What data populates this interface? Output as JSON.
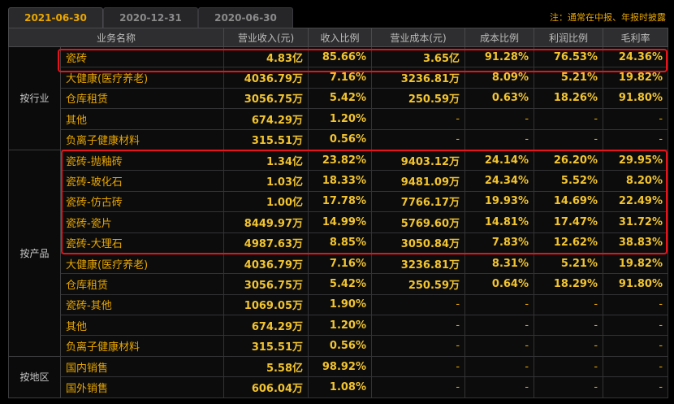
{
  "tabs": [
    "2021-06-30",
    "2020-12-31",
    "2020-06-30"
  ],
  "note": "注：通常在中报、年报时披露",
  "headers": [
    "业务名称",
    "营业收入(元)",
    "收入比例",
    "营业成本(元)",
    "成本比例",
    "利润比例",
    "毛利率"
  ],
  "groups": [
    {
      "label": "按行业",
      "rows": [
        {
          "name": "瓷砖",
          "revenue": "4.83亿",
          "rev_ratio": "85.66%",
          "cost": "3.65亿",
          "cost_ratio": "91.28%",
          "profit_ratio": "76.53%",
          "margin": "24.36%"
        },
        {
          "name": "大健康(医疗养老)",
          "revenue": "4036.79万",
          "rev_ratio": "7.16%",
          "cost": "3236.81万",
          "cost_ratio": "8.09%",
          "profit_ratio": "5.21%",
          "margin": "19.82%"
        },
        {
          "name": "仓库租赁",
          "revenue": "3056.75万",
          "rev_ratio": "5.42%",
          "cost": "250.59万",
          "cost_ratio": "0.63%",
          "profit_ratio": "18.26%",
          "margin": "91.80%"
        },
        {
          "name": "其他",
          "revenue": "674.29万",
          "rev_ratio": "1.20%",
          "cost": "-",
          "cost_ratio": "-",
          "profit_ratio": "-",
          "margin": "-"
        },
        {
          "name": "负离子健康材料",
          "revenue": "315.51万",
          "rev_ratio": "0.56%",
          "cost": "-",
          "cost_ratio": "-",
          "profit_ratio": "-",
          "margin": "-"
        }
      ]
    },
    {
      "label": "按产品",
      "rows": [
        {
          "name": "瓷砖-抛釉砖",
          "revenue": "1.34亿",
          "rev_ratio": "23.82%",
          "cost": "9403.12万",
          "cost_ratio": "24.14%",
          "profit_ratio": "26.20%",
          "margin": "29.95%"
        },
        {
          "name": "瓷砖-玻化石",
          "revenue": "1.03亿",
          "rev_ratio": "18.33%",
          "cost": "9481.09万",
          "cost_ratio": "24.34%",
          "profit_ratio": "5.52%",
          "margin": "8.20%"
        },
        {
          "name": "瓷砖-仿古砖",
          "revenue": "1.00亿",
          "rev_ratio": "17.78%",
          "cost": "7766.17万",
          "cost_ratio": "19.93%",
          "profit_ratio": "14.69%",
          "margin": "22.49%"
        },
        {
          "name": "瓷砖-瓷片",
          "revenue": "8449.97万",
          "rev_ratio": "14.99%",
          "cost": "5769.60万",
          "cost_ratio": "14.81%",
          "profit_ratio": "17.47%",
          "margin": "31.72%"
        },
        {
          "name": "瓷砖-大理石",
          "revenue": "4987.63万",
          "rev_ratio": "8.85%",
          "cost": "3050.84万",
          "cost_ratio": "7.83%",
          "profit_ratio": "12.62%",
          "margin": "38.83%"
        },
        {
          "name": "大健康(医疗养老)",
          "revenue": "4036.79万",
          "rev_ratio": "7.16%",
          "cost": "3236.81万",
          "cost_ratio": "8.31%",
          "profit_ratio": "5.21%",
          "margin": "19.82%"
        },
        {
          "name": "仓库租赁",
          "revenue": "3056.75万",
          "rev_ratio": "5.42%",
          "cost": "250.59万",
          "cost_ratio": "0.64%",
          "profit_ratio": "18.29%",
          "margin": "91.80%"
        },
        {
          "name": "瓷砖-其他",
          "revenue": "1069.05万",
          "rev_ratio": "1.90%",
          "cost": "-",
          "cost_ratio": "-",
          "profit_ratio": "-",
          "margin": "-"
        },
        {
          "name": "其他",
          "revenue": "674.29万",
          "rev_ratio": "1.20%",
          "cost": "-",
          "cost_ratio": "-",
          "profit_ratio": "-",
          "margin": "-"
        },
        {
          "name": "负离子健康材料",
          "revenue": "315.51万",
          "rev_ratio": "0.56%",
          "cost": "-",
          "cost_ratio": "-",
          "profit_ratio": "-",
          "margin": "-"
        }
      ]
    },
    {
      "label": "按地区",
      "rows": [
        {
          "name": "国内销售",
          "revenue": "5.58亿",
          "rev_ratio": "98.92%",
          "cost": "-",
          "cost_ratio": "-",
          "profit_ratio": "-",
          "margin": "-"
        },
        {
          "name": "国外销售",
          "revenue": "606.04万",
          "rev_ratio": "1.08%",
          "cost": "-",
          "cost_ratio": "-",
          "profit_ratio": "-",
          "margin": "-"
        }
      ]
    }
  ],
  "colors": {
    "accent": "#e8a600",
    "value": "#f2c430",
    "highlight": "#e8131b",
    "background": "#000000"
  }
}
